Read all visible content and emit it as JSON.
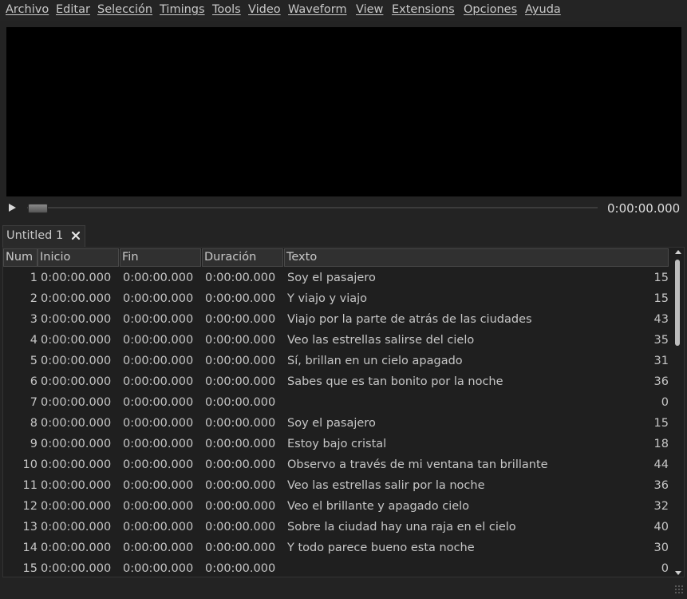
{
  "menu": [
    "Archivo",
    "Editar",
    "Selección",
    "Timings",
    "Tools",
    "Video",
    "Waveform",
    "View",
    "Extensions",
    "Opciones",
    "Ayuda"
  ],
  "player": {
    "time": "0:00:00.000",
    "seek": 0.0
  },
  "tab": {
    "label": "Untitled 1"
  },
  "columns": {
    "num": "Num",
    "start": "Inicio",
    "end": "Fin",
    "duration": "Duración",
    "text": "Texto"
  },
  "rows": [
    {
      "num": "1",
      "start": "0:00:00.000",
      "end": "0:00:00.000",
      "duration": "0:00:00.000",
      "text": "Soy el pasajero",
      "cps": "15"
    },
    {
      "num": "2",
      "start": "0:00:00.000",
      "end": "0:00:00.000",
      "duration": "0:00:00.000",
      "text": "Y viajo y viajo",
      "cps": "15"
    },
    {
      "num": "3",
      "start": "0:00:00.000",
      "end": "0:00:00.000",
      "duration": "0:00:00.000",
      "text": "Viajo por la parte de atrás de las ciudades",
      "cps": "43"
    },
    {
      "num": "4",
      "start": "0:00:00.000",
      "end": "0:00:00.000",
      "duration": "0:00:00.000",
      "text": "Veo las estrellas salirse del cielo",
      "cps": "35"
    },
    {
      "num": "5",
      "start": "0:00:00.000",
      "end": "0:00:00.000",
      "duration": "0:00:00.000",
      "text": "Sí, brillan en un cielo apagado",
      "cps": "31"
    },
    {
      "num": "6",
      "start": "0:00:00.000",
      "end": "0:00:00.000",
      "duration": "0:00:00.000",
      "text": "Sabes que es tan bonito por la noche",
      "cps": "36"
    },
    {
      "num": "7",
      "start": "0:00:00.000",
      "end": "0:00:00.000",
      "duration": "0:00:00.000",
      "text": "",
      "cps": "0"
    },
    {
      "num": "8",
      "start": "0:00:00.000",
      "end": "0:00:00.000",
      "duration": "0:00:00.000",
      "text": "Soy el pasajero",
      "cps": "15"
    },
    {
      "num": "9",
      "start": "0:00:00.000",
      "end": "0:00:00.000",
      "duration": "0:00:00.000",
      "text": "Estoy bajo cristal",
      "cps": "18"
    },
    {
      "num": "10",
      "start": "0:00:00.000",
      "end": "0:00:00.000",
      "duration": "0:00:00.000",
      "text": "Observo a través de mi ventana tan brillante",
      "cps": "44"
    },
    {
      "num": "11",
      "start": "0:00:00.000",
      "end": "0:00:00.000",
      "duration": "0:00:00.000",
      "text": "Veo las estrellas salir por la noche",
      "cps": "36"
    },
    {
      "num": "12",
      "start": "0:00:00.000",
      "end": "0:00:00.000",
      "duration": "0:00:00.000",
      "text": "Veo el brillante y apagado cielo",
      "cps": "32"
    },
    {
      "num": "13",
      "start": "0:00:00.000",
      "end": "0:00:00.000",
      "duration": "0:00:00.000",
      "text": "Sobre la ciudad hay una raja en el cielo",
      "cps": "40"
    },
    {
      "num": "14",
      "start": "0:00:00.000",
      "end": "0:00:00.000",
      "duration": "0:00:00.000",
      "text": "Y todo parece bueno esta noche",
      "cps": "30"
    },
    {
      "num": "15",
      "start": "0:00:00.000",
      "end": "0:00:00.000",
      "duration": "0:00:00.000",
      "text": "",
      "cps": "0"
    }
  ],
  "icons": {
    "play": "play-icon",
    "close": "close-icon",
    "scroll_up": "arrow-up-icon",
    "scroll_down": "arrow-down-icon",
    "grip": "resize-grip-icon"
  }
}
